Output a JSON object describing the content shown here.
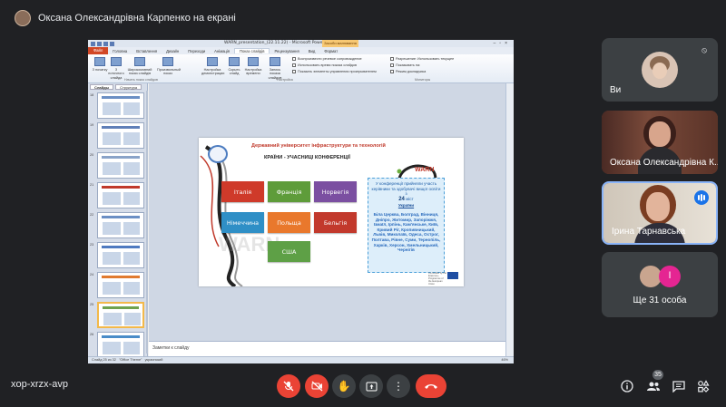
{
  "top_bar": {
    "presenter_text": "Оксана Олександрівна Карпенко на екрані"
  },
  "powerpoint": {
    "window_title": "WARN_presentation_(22.11.22) - Microsoft PowerPoint",
    "contextual_tab": "Засоби малювання",
    "tabs": [
      "Файл",
      "Головна",
      "Вставлення",
      "Дизайн",
      "Переходи",
      "Анімація",
      "Показ слайдів",
      "Рецензування",
      "Вид",
      "Формат"
    ],
    "ribbon": {
      "buttons": [
        "З початку",
        "З поточного слайда",
        "Широкомовний показ слайдів",
        "Произвольный показ",
        "Настройка демонстрации",
        "Скрыть слайд",
        "Настройка времени",
        "Запись показа слайдов"
      ],
      "checks": [
        "Воспроизвести речевое сопровождение",
        "Использовать время показа слайдов",
        "Показать элементы управления проигрывателем",
        "Разрешение: Использовать текущее",
        "Показывать на:",
        "Режим докладчика"
      ],
      "groups": [
        "Начать показ слайдов",
        "Настройка",
        "Мониторы"
      ]
    },
    "left_pane_tabs": [
      "Слайды",
      "Структура"
    ],
    "slide_numbers": [
      "18",
      "19",
      "20",
      "21",
      "22",
      "23",
      "24",
      "25",
      "26"
    ],
    "notes_placeholder": "Заметки к слайду",
    "status": {
      "slide_info": "Слайд 25 из 32",
      "theme": "\"Office Theme\"",
      "language": "украинский",
      "zoom": "46%"
    },
    "slide": {
      "university": "Державний університет інфраструктури та технологій",
      "heading": "КРАЇНИ - УЧАСНИЦІ КОНФЕРЕНЦІЇ",
      "watermark": "WARN",
      "warn_logo": "WARN",
      "countries": [
        "Італія",
        "Франція",
        "Норвегія",
        "Німеччина",
        "Польща",
        "Бельгія",
        "США"
      ],
      "info": {
        "line1": "У конференції прийняли участь керівники та здобувачі вищої освіти з",
        "count": "24",
        "count_suffix": "міст",
        "country": "України",
        "cities": "Біла Церква, Болград, Вінниця, Дніпро, Житомир, Запоріжжя, Ізмаїл, Ірпінь, Кам'янське, Київ, Кривий Ріг, Кропивницький, Львів, Миколаїв, Одеса, Острог, Полтава, Рівне, Суми, Тернопіль, Харків, Херсон, Хмельницький, Чернігів"
      },
      "eu_caption": "Co-funded by the Erasmus+ Programme of the European Union"
    }
  },
  "participants": [
    {
      "name": "Ви",
      "muted": true
    },
    {
      "name": "Оксана Олександрівна К...",
      "muted": false
    },
    {
      "name": "Ірина Тарнавська",
      "speaking": true
    },
    {
      "name": "Ще 31 особа"
    }
  ],
  "bottom_bar": {
    "meeting_code": "xop-xrzx-avp",
    "participant_count": "35"
  },
  "colors": {
    "background": "#202124",
    "tile": "#3c4043",
    "red": "#ea4335",
    "blue": "#1a73e8",
    "italy": "#cf3a2a",
    "france": "#5e9c3a",
    "norway": "#7b4fa1",
    "germany": "#2f8fc6",
    "poland": "#e9782c",
    "belgium": "#c2392c",
    "usa": "#5ea046"
  }
}
